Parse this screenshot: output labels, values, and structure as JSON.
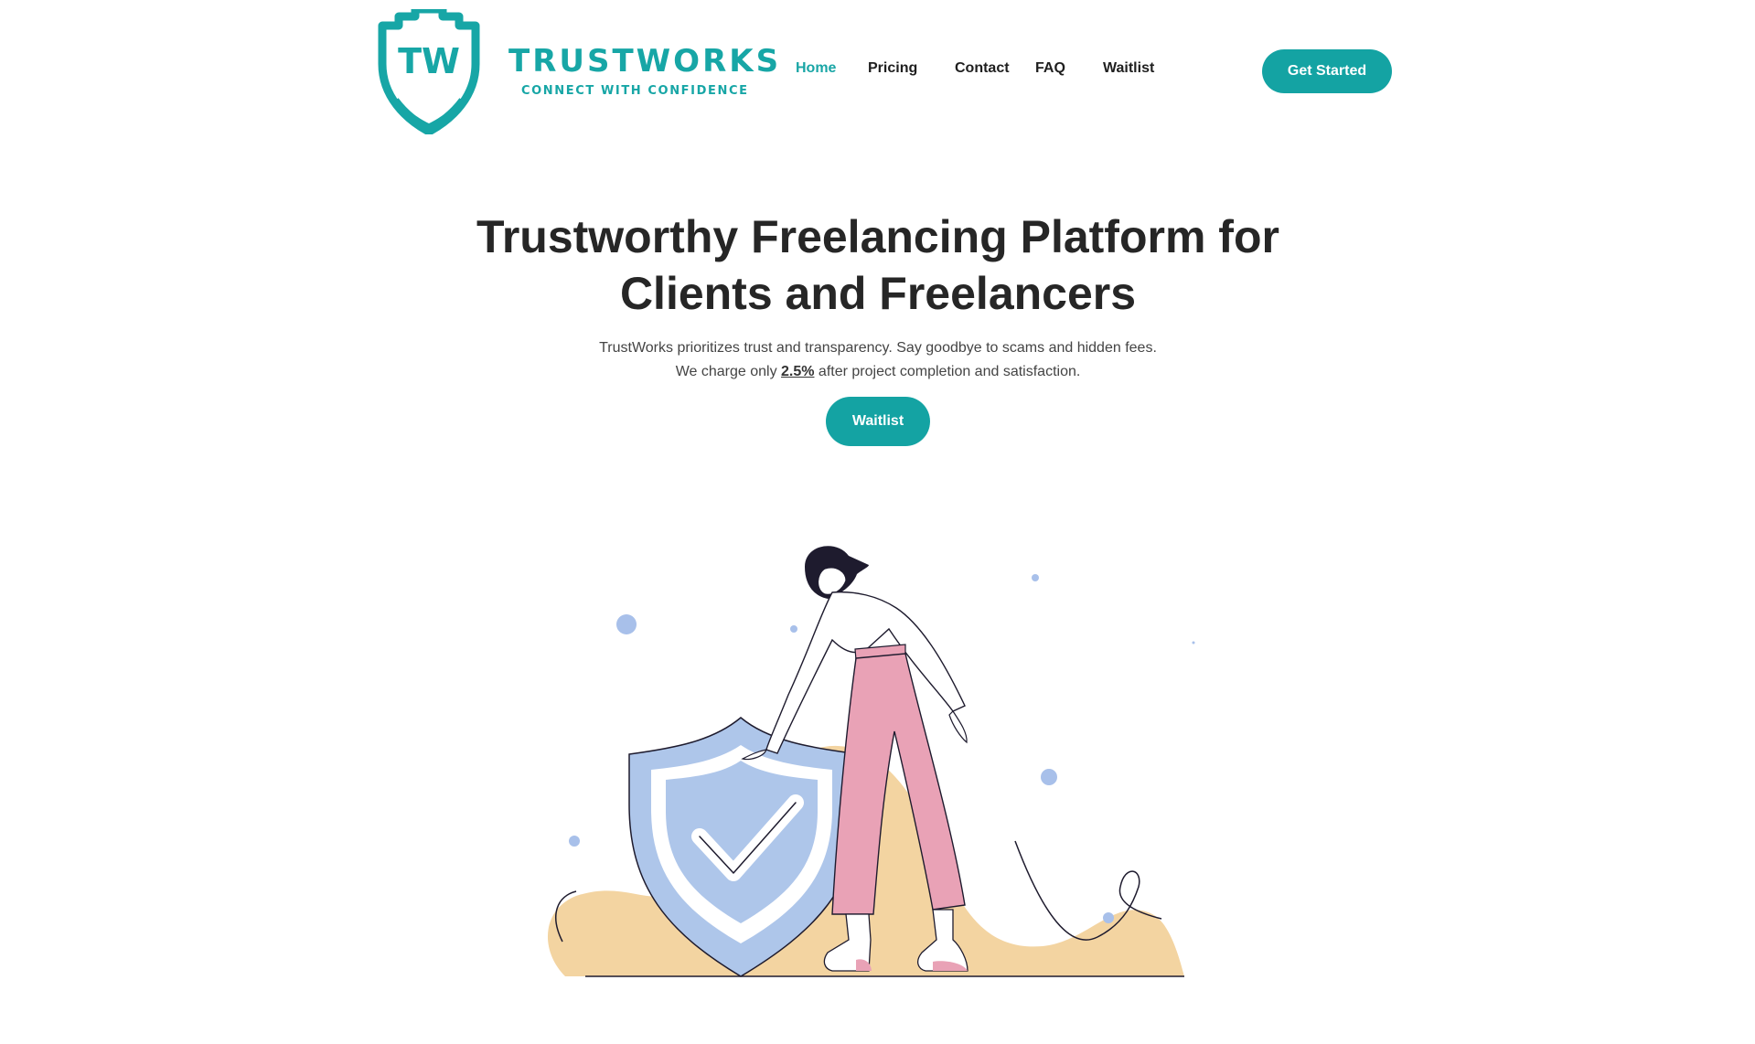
{
  "brand": {
    "monogram": "TW",
    "name": "TRUSTWORKS",
    "tagline": "CONNECT WITH CONFIDENCE",
    "color": "#17a6a6"
  },
  "nav": {
    "items": [
      {
        "label": "Home",
        "active": true
      },
      {
        "label": "Pricing",
        "active": false
      },
      {
        "label": "Contact",
        "active": false
      },
      {
        "label": "FAQ",
        "active": false
      },
      {
        "label": "Waitlist",
        "active": false
      }
    ],
    "cta_label": "Get Started"
  },
  "hero": {
    "title_line1": "Trustworthy Freelancing Platform for",
    "title_line2": "Clients and Freelancers",
    "subtitle_line1": "TrustWorks prioritizes trust and transparency. Say goodbye to scams and hidden fees.",
    "subtitle_line2_prefix": "We charge only ",
    "fee": "2.5%",
    "subtitle_line2_suffix": " after project completion and satisfaction.",
    "cta_label": "Waitlist"
  },
  "illustration": {
    "subject": "woman leaning on a shield with a check mark",
    "icons": [
      "shield-check-icon"
    ],
    "colors": {
      "shield": "#aec6ea",
      "blob": "#f3d4a1",
      "pants": "#e9a2b6",
      "dots": "#a8c0ea",
      "line": "#1e1b2e"
    }
  },
  "theme": {
    "accent": "#14a3a3",
    "text": "#262626"
  }
}
